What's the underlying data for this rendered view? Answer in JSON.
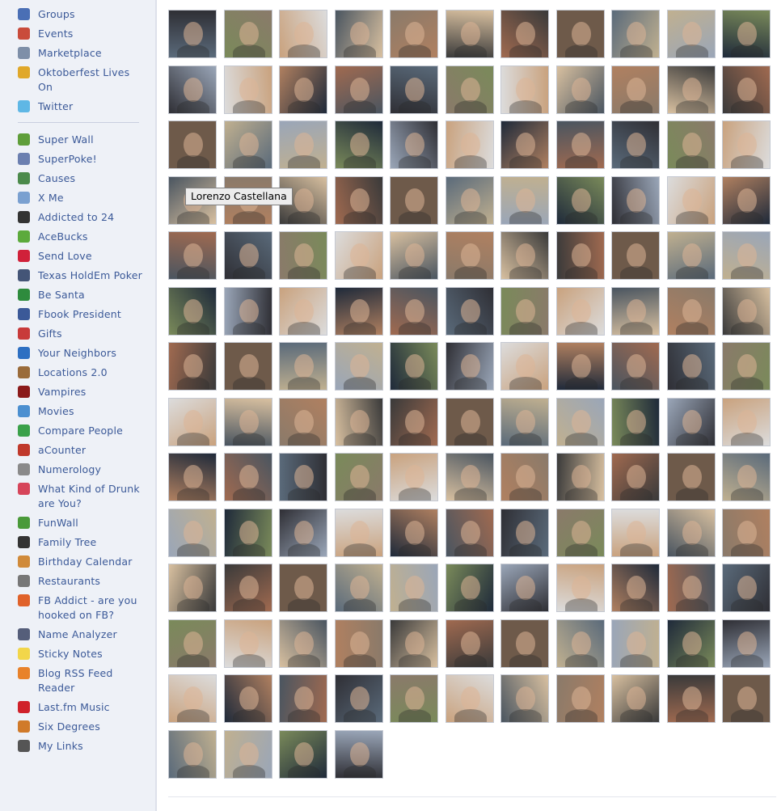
{
  "sidebar": {
    "group1": [
      {
        "label": "Groups",
        "icon": "groups-icon",
        "color": "#4a6fb5"
      },
      {
        "label": "Events",
        "icon": "events-icon",
        "color": "#c94b3b"
      },
      {
        "label": "Marketplace",
        "icon": "marketplace-icon",
        "color": "#7e8fa8"
      },
      {
        "label": "Oktoberfest Lives On",
        "icon": "oktoberfest-icon",
        "color": "#e0a82a"
      },
      {
        "label": "Twitter",
        "icon": "twitter-icon",
        "color": "#5fb7e5"
      }
    ],
    "group2": [
      {
        "label": "Super Wall",
        "icon": "super-wall-icon",
        "color": "#5f9e3a"
      },
      {
        "label": "SuperPoke!",
        "icon": "superpoke-icon",
        "color": "#6b7fb0"
      },
      {
        "label": "Causes",
        "icon": "causes-icon",
        "color": "#4b8a4b"
      },
      {
        "label": "X Me",
        "icon": "x-me-icon",
        "color": "#7aa0d0"
      },
      {
        "label": "Addicted to 24",
        "icon": "addicted-24-icon",
        "color": "#333333"
      },
      {
        "label": "AceBucks",
        "icon": "acebucks-icon",
        "color": "#5caa3c"
      },
      {
        "label": "Send Love",
        "icon": "heart-icon",
        "color": "#d0213a"
      },
      {
        "label": "Texas HoldEm Poker",
        "icon": "poker-icon",
        "color": "#445577"
      },
      {
        "label": "Be Santa",
        "icon": "santa-icon",
        "color": "#2e8b3d"
      },
      {
        "label": "Fbook President",
        "icon": "president-icon",
        "color": "#3b5998"
      },
      {
        "label": "Gifts",
        "icon": "gifts-icon",
        "color": "#c83a3a"
      },
      {
        "label": "Your Neighbors",
        "icon": "neighbors-icon",
        "color": "#2d6fc2"
      },
      {
        "label": "Locations 2.0",
        "icon": "locations-icon",
        "color": "#9a6b3a"
      },
      {
        "label": "Vampires",
        "icon": "vampires-icon",
        "color": "#8b1a1a"
      },
      {
        "label": "Movies",
        "icon": "movies-icon",
        "color": "#4b8fd0"
      },
      {
        "label": "Compare People",
        "icon": "compare-people-icon",
        "color": "#3aa14a"
      },
      {
        "label": "aCounter",
        "icon": "acounter-icon",
        "color": "#c0392b"
      },
      {
        "label": "Numerology",
        "icon": "numerology-icon",
        "color": "#8a8a8a"
      },
      {
        "label": "What Kind of Drunk are You?",
        "icon": "drunk-icon",
        "color": "#d6455a"
      },
      {
        "label": "FunWall",
        "icon": "funwall-icon",
        "color": "#4a9a3a"
      },
      {
        "label": "Family Tree",
        "icon": "family-tree-icon",
        "color": "#333333"
      },
      {
        "label": "Birthday Calendar",
        "icon": "birthday-cake-icon",
        "color": "#d08a3a"
      },
      {
        "label": "Restaurants",
        "icon": "restaurants-icon",
        "color": "#777777"
      },
      {
        "label": "FB Addict - are you hooked on FB?",
        "icon": "fb-addict-icon",
        "color": "#e0622a"
      },
      {
        "label": "Name Analyzer",
        "icon": "name-analyzer-icon",
        "color": "#555e7a"
      },
      {
        "label": "Sticky Notes",
        "icon": "sticky-notes-icon",
        "color": "#f2d64a"
      },
      {
        "label": "Blog RSS Feed Reader",
        "icon": "rss-icon",
        "color": "#e8822a"
      },
      {
        "label": "Last.fm Music",
        "icon": "lastfm-icon",
        "color": "#d0212a"
      },
      {
        "label": "Six Degrees",
        "icon": "six-degrees-icon",
        "color": "#d07a2a"
      },
      {
        "label": "My Links",
        "icon": "my-links-icon",
        "color": "#555555"
      }
    ]
  },
  "tooltip": {
    "text": "Lorenzo Castellana"
  },
  "friends": {
    "columns": 11,
    "count": 147,
    "palette": [
      "#3a3a3a",
      "#8a7a6a",
      "#c9a27e",
      "#5a6a7a",
      "#b08060",
      "#2f2f35",
      "#9aa6b8",
      "#6e5a4a",
      "#d8c0a0",
      "#4a5560",
      "#7a8a5a",
      "#a06a50",
      "#dcdcdc",
      "#1f2a3a",
      "#c0b090"
    ]
  }
}
